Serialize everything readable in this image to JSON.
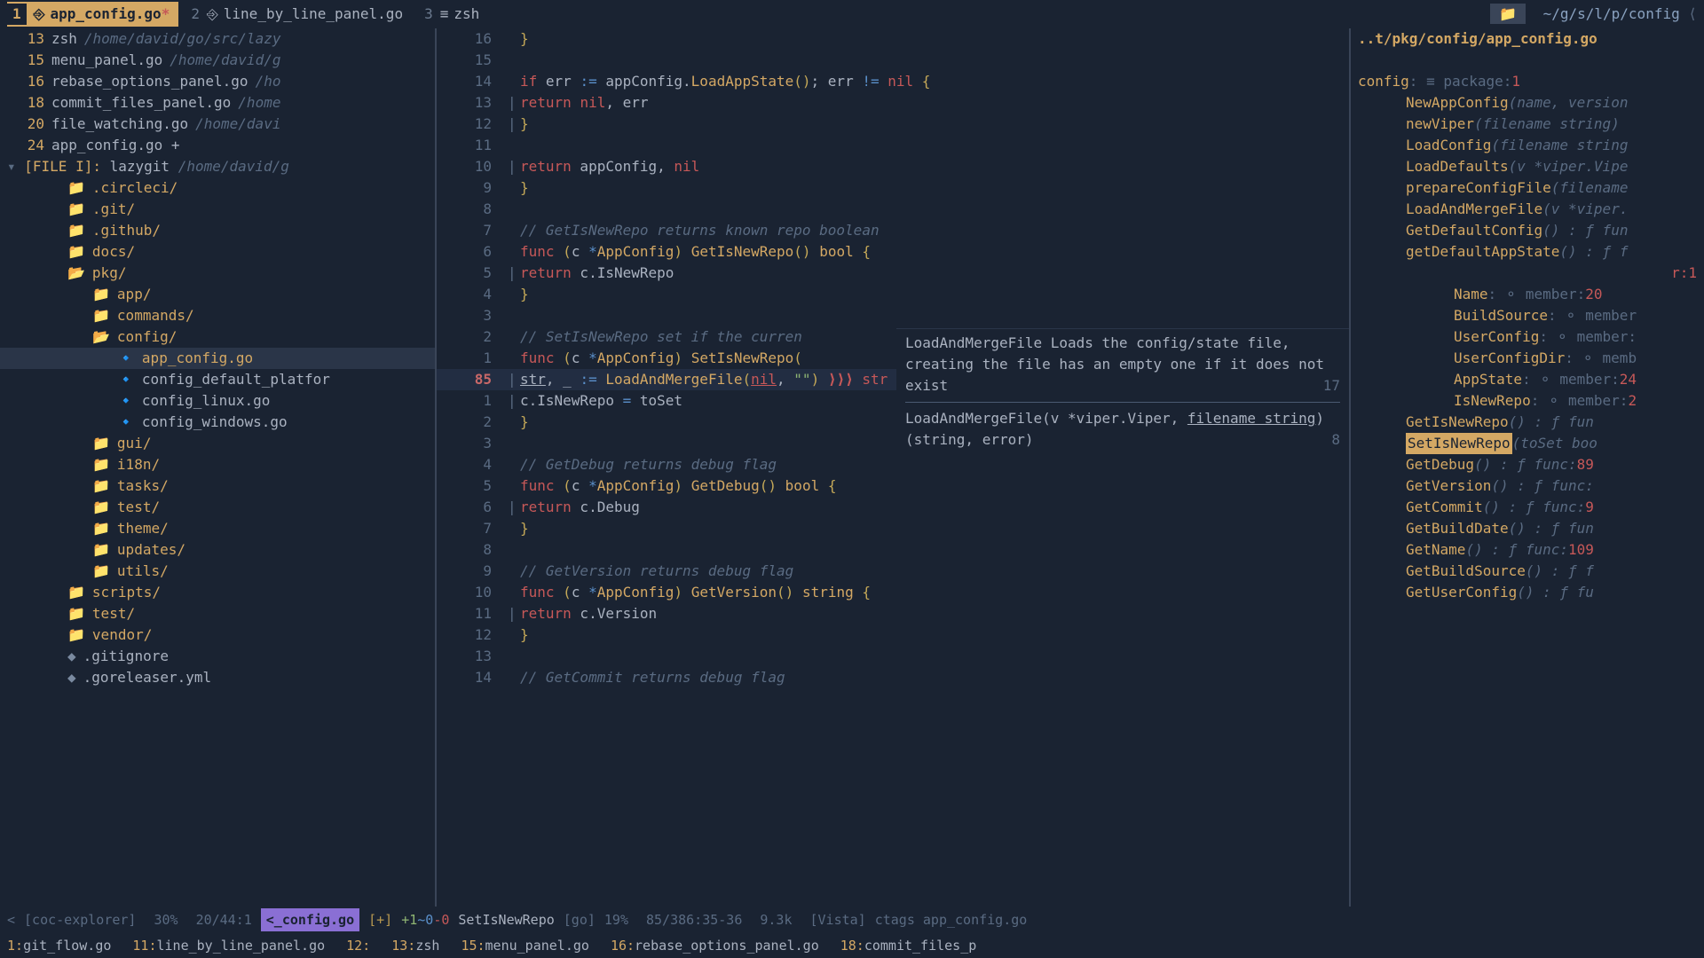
{
  "tabs": [
    {
      "num": "1",
      "icon": "⎆",
      "label": "app_config.go",
      "modified": "*",
      "active": true
    },
    {
      "num": "2",
      "icon": "⎆",
      "label": "line_by_line_panel.go",
      "active": false
    },
    {
      "num": "3",
      "icon": "≡",
      "label": "zsh",
      "active": false
    }
  ],
  "path_short": "~/g/s/l/p/config",
  "breadcrumb": "..t/pkg/config/app_config.go",
  "recent_files": [
    {
      "num": "13",
      "name": "zsh",
      "path": "/home/david/go/src/lazy"
    },
    {
      "num": "15",
      "name": "menu_panel.go",
      "path": "/home/david/g"
    },
    {
      "num": "16",
      "name": "rebase_options_panel.go",
      "path": "/ho"
    },
    {
      "num": "18",
      "name": "commit_files_panel.go",
      "path": "/home"
    },
    {
      "num": "20",
      "name": "file_watching.go",
      "path": "/home/davi"
    },
    {
      "num": "24",
      "name": "app_config.go +",
      "path": ""
    }
  ],
  "file_i": {
    "label": "[FILE I]:",
    "name": "lazygit",
    "path": "/home/david/g"
  },
  "tree": [
    {
      "depth": 1,
      "icon": "folder",
      "name": ".circleci/"
    },
    {
      "depth": 1,
      "icon": "folder",
      "name": ".git/"
    },
    {
      "depth": 1,
      "icon": "folder",
      "name": ".github/"
    },
    {
      "depth": 1,
      "icon": "folder",
      "name": "docs/"
    },
    {
      "depth": 1,
      "icon": "folder-open",
      "name": "pkg/"
    },
    {
      "depth": 2,
      "icon": "folder",
      "name": "app/"
    },
    {
      "depth": 2,
      "icon": "folder",
      "name": "commands/"
    },
    {
      "depth": 2,
      "icon": "folder-open",
      "name": "config/"
    },
    {
      "depth": 3,
      "icon": "go",
      "name": "app_config.go",
      "selected": true
    },
    {
      "depth": 3,
      "icon": "go",
      "name": "config_default_platfor"
    },
    {
      "depth": 3,
      "icon": "go",
      "name": "config_linux.go"
    },
    {
      "depth": 3,
      "icon": "go",
      "name": "config_windows.go"
    },
    {
      "depth": 2,
      "icon": "folder",
      "name": "gui/"
    },
    {
      "depth": 2,
      "icon": "folder",
      "name": "i18n/"
    },
    {
      "depth": 2,
      "icon": "folder",
      "name": "tasks/"
    },
    {
      "depth": 2,
      "icon": "folder",
      "name": "test/"
    },
    {
      "depth": 2,
      "icon": "folder",
      "name": "theme/"
    },
    {
      "depth": 2,
      "icon": "folder",
      "name": "updates/"
    },
    {
      "depth": 2,
      "icon": "folder",
      "name": "utils/"
    },
    {
      "depth": 1,
      "icon": "folder",
      "name": "scripts/"
    },
    {
      "depth": 1,
      "icon": "folder",
      "name": "test/"
    },
    {
      "depth": 1,
      "icon": "folder",
      "name": "vendor/"
    },
    {
      "depth": 1,
      "icon": "diamond",
      "name": ".gitignore"
    },
    {
      "depth": 1,
      "icon": "diamond",
      "name": ".goreleaser.yml"
    }
  ],
  "code_lines": [
    {
      "n": "16",
      "rel": false,
      "html": "<span class='paren'>}</span>"
    },
    {
      "n": "15",
      "rel": false,
      "html": ""
    },
    {
      "n": "14",
      "rel": false,
      "html": "<span class='kw'>if</span> err <span class='op'>:=</span> appConfig.<span class='fn'>LoadAppState</span><span class='paren'>()</span>; err <span class='op'>!=</span> <span class='nil'>nil</span> <span class='paren'>{</span>"
    },
    {
      "n": "13",
      "rel": false,
      "fold": "|",
      "html": "  <span class='kw'>return</span> <span class='nil'>nil</span>, err"
    },
    {
      "n": "12",
      "rel": false,
      "fold": "|",
      "html": "<span class='paren'>}</span>"
    },
    {
      "n": "11",
      "rel": false,
      "html": ""
    },
    {
      "n": "10",
      "rel": false,
      "fold": "|",
      "html": "<span class='kw'>return</span> appConfig, <span class='nil'>nil</span>"
    },
    {
      "n": "9",
      "rel": false,
      "html": "<span class='paren'>}</span>"
    },
    {
      "n": "8",
      "rel": false,
      "html": ""
    },
    {
      "n": "7",
      "rel": false,
      "html": "<span class='cmt'>// GetIsNewRepo returns known repo boolean</span>"
    },
    {
      "n": "6",
      "rel": false,
      "html": "<span class='kw'>func</span> <span class='paren'>(</span>c <span class='op'>*</span><span class='type'>AppConfig</span><span class='paren'>)</span> <span class='fn'>GetIsNewRepo</span><span class='paren'>()</span> <span class='type'>bool</span> <span class='paren'>{</span>"
    },
    {
      "n": "5",
      "rel": false,
      "fold": "|",
      "html": "<span class='kw'>return</span> c.IsNewRepo"
    },
    {
      "n": "4",
      "rel": false,
      "html": "<span class='paren'>}</span>"
    },
    {
      "n": "3",
      "rel": false,
      "html": ""
    },
    {
      "n": "2",
      "rel": false,
      "html": "<span class='cmt'>// SetIsNewRepo set if the curren</span>"
    },
    {
      "n": "1",
      "rel": false,
      "html": "<span class='kw'>func</span> <span class='paren'>(</span>c <span class='op'>*</span><span class='type'>AppConfig</span><span class='paren'>)</span> <span class='fn'>SetIsNewRepo</span><span class='paren'>(</span>"
    },
    {
      "n": "85",
      "rel": true,
      "fold": "|",
      "html": "  <span class='underline'>str</span>, _ <span class='op'>:=</span> <span class='fn'>LoadAndMergeFile</span><span class='paren'>(</span><span class='nil underline'>nil</span>, <span class='str'>\"</span><span class='str'>\"</span><span class='paren'>)</span>   <span class='err-marker'>⟩⟩⟩</span> <span class='err'>str declared but not u</span>"
    },
    {
      "n": "1",
      "rel": false,
      "fold": "|",
      "html": "  c.IsNewRepo <span class='op'>=</span> toSet"
    },
    {
      "n": "2",
      "rel": false,
      "html": "<span class='paren'>}</span>"
    },
    {
      "n": "3",
      "rel": false,
      "html": ""
    },
    {
      "n": "4",
      "rel": false,
      "html": "<span class='cmt'>// GetDebug returns debug flag</span>"
    },
    {
      "n": "5",
      "rel": false,
      "html": "<span class='kw'>func</span> <span class='paren'>(</span>c <span class='op'>*</span><span class='type'>AppConfig</span><span class='paren'>)</span> <span class='fn'>GetDebug</span><span class='paren'>()</span> <span class='type'>bool</span> <span class='paren'>{</span>"
    },
    {
      "n": "6",
      "rel": false,
      "fold": "|",
      "html": "<span class='kw'>return</span> c.Debug"
    },
    {
      "n": "7",
      "rel": false,
      "html": "<span class='paren'>}</span>"
    },
    {
      "n": "8",
      "rel": false,
      "html": ""
    },
    {
      "n": "9",
      "rel": false,
      "html": "<span class='cmt'>// GetVersion returns debug flag</span>"
    },
    {
      "n": "10",
      "rel": false,
      "html": "<span class='kw'>func</span> <span class='paren'>(</span>c <span class='op'>*</span><span class='type'>AppConfig</span><span class='paren'>)</span> <span class='fn'>GetVersion</span><span class='paren'>()</span> <span class='type'>string</span> <span class='paren'>{</span>"
    },
    {
      "n": "11",
      "rel": false,
      "fold": "|",
      "html": "<span class='kw'>return</span> c.Version"
    },
    {
      "n": "12",
      "rel": false,
      "html": "<span class='paren'>}</span>"
    },
    {
      "n": "13",
      "rel": false,
      "html": ""
    },
    {
      "n": "14",
      "rel": false,
      "html": "<span class='cmt'>// GetCommit returns debug flag</span>"
    }
  ],
  "tooltip": {
    "doc": "LoadAndMergeFile Loads the config/state file, creating the file has an empty one if it does not exist",
    "sig_pre": "LoadAndMergeFile(v *viper.Viper, ",
    "sig_hl": "filename string",
    "sig_post": ") (string, error)",
    "num1": "17",
    "num2": "8"
  },
  "outline_header": {
    "name": "config",
    "meta": " : ≡ package:",
    "num": "1"
  },
  "outline": [
    {
      "d": 1,
      "name": "NewAppConfig",
      "args": "(name, version"
    },
    {
      "d": 1,
      "name": "newViper",
      "args": "(filename string)"
    },
    {
      "d": 1,
      "name": "LoadConfig",
      "args": "(filename string"
    },
    {
      "d": 1,
      "name": "LoadDefaults",
      "args": "(v *viper.Vipe"
    },
    {
      "d": 1,
      "name": "prepareConfigFile",
      "args": "(filename"
    },
    {
      "d": 1,
      "name": "LoadAndMergeFile",
      "args": "(v *viper."
    },
    {
      "d": 1,
      "name": "GetDefaultConfig",
      "args": "() : ƒ fun"
    },
    {
      "d": 1,
      "name": "getDefaultAppState",
      "args": "() : ƒ f"
    },
    {
      "d": 1,
      "hole": true
    },
    {
      "d": 1,
      "hole": true
    },
    {
      "d": 1,
      "hole": true,
      "tail": "r:1"
    },
    {
      "d": 2,
      "member": "Name",
      "meta": " : ⚬ member:",
      "num": "20"
    },
    {
      "d": 2,
      "member": "BuildSource",
      "meta": " : ⚬ member"
    },
    {
      "d": 2,
      "member": "UserConfig",
      "meta": " : ⚬ member:"
    },
    {
      "d": 2,
      "member": "UserConfigDir",
      "meta": " : ⚬ memb"
    },
    {
      "d": 2,
      "member": "AppState",
      "meta": " : ⚬ member:",
      "num": "24"
    },
    {
      "d": 2,
      "member": "IsNewRepo",
      "meta": " : ⚬ member:",
      "num": "2"
    },
    {
      "d": 1,
      "name": "GetIsNewRepo",
      "args": "() : ƒ fun"
    },
    {
      "d": 1,
      "hl": "SetIsNewRepo",
      "args": "(toSet boo"
    },
    {
      "d": 1,
      "name": "GetDebug",
      "args": "() : ƒ func:",
      "num": "89"
    },
    {
      "d": 1,
      "name": "GetVersion",
      "args": "() : ƒ func:"
    },
    {
      "d": 1,
      "name": "GetCommit",
      "args": "() : ƒ func:",
      "num": "9"
    },
    {
      "d": 1,
      "name": "GetBuildDate",
      "args": "() : ƒ fun"
    },
    {
      "d": 1,
      "name": "GetName",
      "args": "() : ƒ func:",
      "num": "109"
    },
    {
      "d": 1,
      "name": "GetBuildSource",
      "args": "() : ƒ f"
    },
    {
      "d": 1,
      "name": "GetUserConfig",
      "args": "() : ƒ fu"
    }
  ],
  "status": {
    "left_arrow": "<",
    "explorer": "[coc-explorer]",
    "pct1": "30%",
    "pos1": "20/44:1",
    "file_hl": "<_config.go",
    "modified": "[+]",
    "diff": {
      "add": "+1",
      "mod": "~0",
      "del": "-0"
    },
    "func": "SetIsNewRepo",
    "lang": "[go]",
    "pct2": "19%",
    "pos2": "85/386:35-36",
    "size": "9.3k",
    "vista": "[Vista]",
    "tags": "ctags app_config.go"
  },
  "buffers": [
    {
      "num": "1:",
      "name": "git_flow.go"
    },
    {
      "num": "11:",
      "name": "line_by_line_panel.go"
    },
    {
      "num": "12:",
      "name": ""
    },
    {
      "num": "13:",
      "name": "zsh"
    },
    {
      "num": "15:",
      "name": "menu_panel.go"
    },
    {
      "num": "16:",
      "name": "rebase_options_panel.go"
    },
    {
      "num": "18:",
      "name": "commit_files_p"
    }
  ]
}
